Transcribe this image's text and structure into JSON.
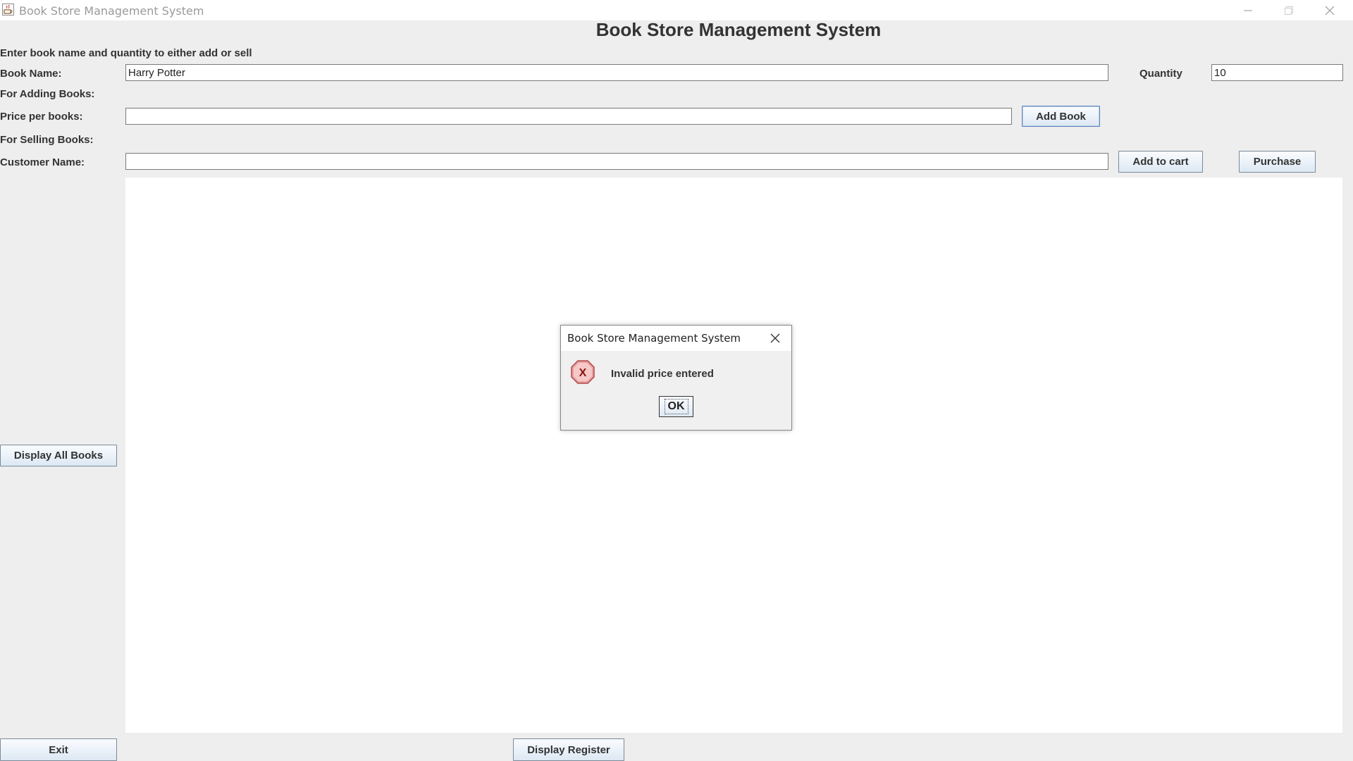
{
  "window": {
    "title": "Book Store Management System"
  },
  "header": {
    "heading": "Book Store Management System",
    "instruction": "Enter book name and quantity to either add or sell"
  },
  "form": {
    "book_name_label": "Book Name:",
    "book_name_value": "Harry Potter",
    "quantity_label": "Quantity",
    "quantity_value": "10",
    "adding_section_label": "For Adding Books:",
    "price_label": "Price per books:",
    "price_value": "",
    "add_book_label": "Add Book",
    "selling_section_label": "For Selling Books:",
    "customer_label": "Customer Name:",
    "customer_value": "",
    "add_to_cart_label": "Add to cart",
    "purchase_label": "Purchase"
  },
  "side": {
    "display_all_label": "Display All Books",
    "exit_label": "Exit"
  },
  "footer": {
    "display_register_label": "Display Register"
  },
  "dialog": {
    "title": "Book Store Management System",
    "message": "Invalid price entered",
    "ok_label": "OK",
    "icon": "error-icon"
  }
}
